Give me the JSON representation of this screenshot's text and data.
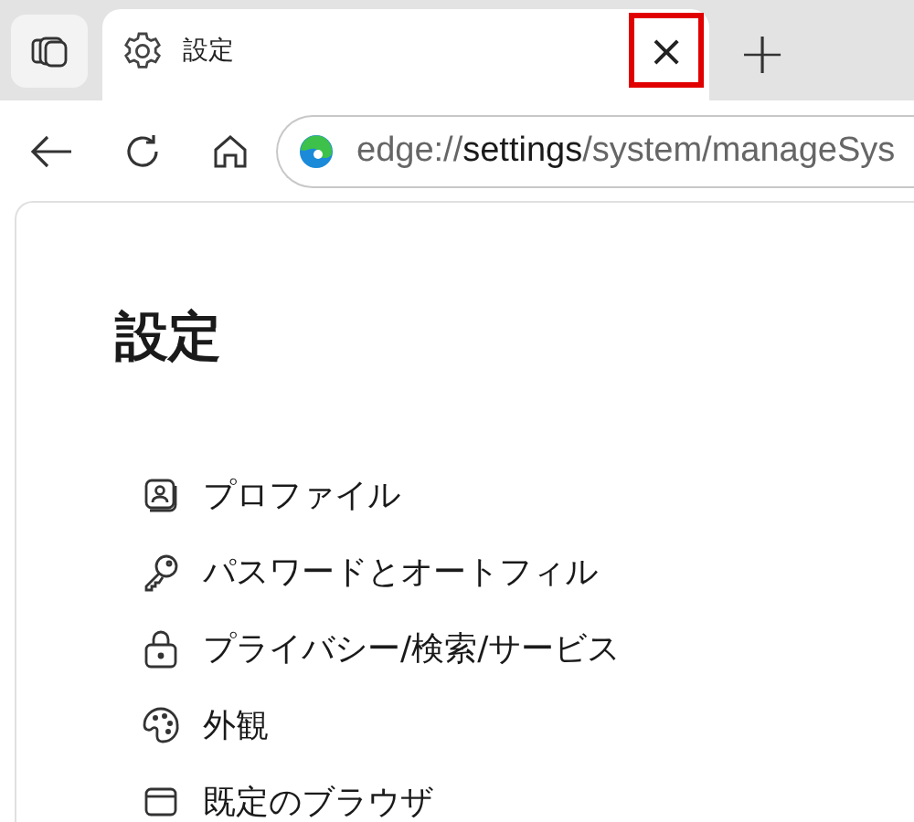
{
  "tab": {
    "title": "設定",
    "selected": true,
    "close": {
      "label": "×",
      "highlighted": true
    }
  },
  "new_tab": {
    "label": "+"
  },
  "address_bar": {
    "scheme": "edge://",
    "host": "settings",
    "path": "/system/manageSys"
  },
  "page": {
    "heading": "設定",
    "nav_items": [
      {
        "label": "プロファイル",
        "kind": "profile"
      },
      {
        "label": "パスワードとオートフィル",
        "kind": "key"
      },
      {
        "label": "プライバシー/検索/サービス",
        "kind": "lock"
      },
      {
        "label": "外観",
        "kind": "palette"
      },
      {
        "label": "既定のブラウザ",
        "kind": "browser"
      }
    ]
  }
}
